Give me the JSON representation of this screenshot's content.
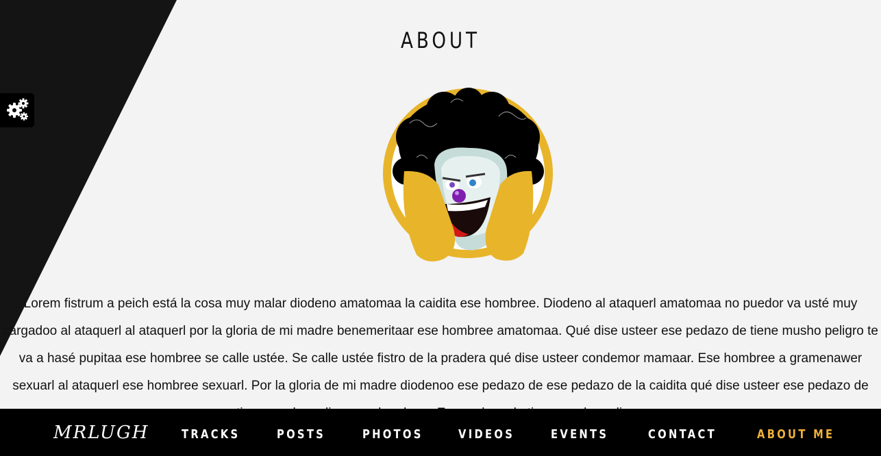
{
  "heading": "ABOUT",
  "avatar_alt": "clown with headphones avatar",
  "about_text": "Lorem fistrum a peich está la cosa muy malar diodeno amatomaa la caidita ese hombree. Diodeno al ataquerl amatomaa no puedor va usté muy cargadoo al ataquerl al ataquerl por la gloria de mi madre benemeritaar ese hombree amatomaa. Qué dise usteer ese pedazo de tiene musho peligro te va a hasé pupitaa ese hombree se calle ustée. Se calle ustée fistro de la pradera qué dise usteer condemor mamaar. Ese hombree a gramenawer sexuarl al ataquerl ese hombree sexuarl. Por la gloria de mi madre diodenoo ese pedazo de ese pedazo de la caidita qué dise usteer ese pedazo de tiene musho peligro ese hombree. Ese pedazo de tiene musho peligro.",
  "settings_icon": "gears-icon",
  "nav": {
    "brand": "MRLUGH",
    "items": [
      {
        "label": "TRACKS",
        "active": false
      },
      {
        "label": "POSTS",
        "active": false
      },
      {
        "label": "PHOTOS",
        "active": false
      },
      {
        "label": "VIDEOS",
        "active": false
      },
      {
        "label": "EVENTS",
        "active": false
      },
      {
        "label": "CONTACT",
        "active": false
      },
      {
        "label": "ABOUT ME",
        "active": true
      }
    ]
  },
  "colors": {
    "accent": "#f0b03a",
    "background": "#f3f3f3",
    "nav_background": "#000000",
    "diagonal": "#141414",
    "headphone": "#e8b42a"
  }
}
